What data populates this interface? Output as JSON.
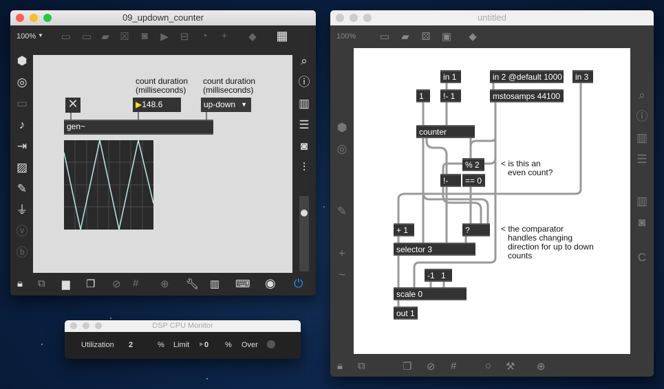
{
  "left_window": {
    "title": "09_updown_counter",
    "zoom": "100%",
    "toolbar_icons": [
      "presentation-icon",
      "message-icon",
      "comment-icon",
      "toggle-icon",
      "button-icon",
      "play-icon",
      "slider-icon",
      "dial-icon",
      "plus-icon",
      "paint-bucket-icon",
      "grid-icon"
    ],
    "sidebar_left": [
      "cube-icon",
      "target-icon",
      "keyboard-icon",
      "note-icon",
      "step-icon",
      "image-icon",
      "clip-icon",
      "plug-icon",
      "v-icon",
      "b-icon"
    ],
    "sidebar_right": [
      "search-icon",
      "info-icon",
      "book-icon",
      "list-icon",
      "camera-icon",
      "mixer-icon"
    ],
    "patch": {
      "toggle": "✕",
      "number_value": "148.6",
      "comment1": "count duration\n(milliseconds)",
      "comment2": "count duration\n(milliseconds)",
      "umenu_value": "up-down",
      "gen_label": "gen~"
    },
    "bottom_icons": [
      "lock-icon",
      "edit-icon",
      "presentation-icon",
      "windows-icon",
      "hide-icon",
      "grid-icon",
      "add-icon",
      "wrench-icon",
      "piano-icon",
      "keyboard-icon",
      "dsp-play-icon",
      "power-icon"
    ],
    "dsp_on_color": "#2a8cff"
  },
  "cpu_monitor": {
    "title": "DSP CPU Monitor",
    "utilization_label": "Utilization",
    "utilization_value": "2",
    "pct1": "%",
    "limit_label": "Limit",
    "limit_value": "0",
    "pct2": "%",
    "over_label": "Over"
  },
  "right_window": {
    "title": "untitled",
    "zoom": "100%",
    "objects": {
      "in1": "in 1",
      "in2": "in 2 @default 1000",
      "in3": "in 3",
      "one": "1",
      "rminus1": "!- 1",
      "mstosamps": "mstosamps 44100",
      "counter": "counter",
      "mod2": "% 2",
      "rminus": "!-",
      "eq0": "== 0",
      "plus1": "+ 1",
      "q": "?",
      "selector": "selector 3",
      "neg1": "-1",
      "pos1": "1",
      "scale": "scale 0",
      "out1": "out 1"
    },
    "comments": {
      "even": "< is this an\n   even count?",
      "comparator": "< the comparator\n   handles changing\n   direction for up to down\n   counts"
    }
  }
}
